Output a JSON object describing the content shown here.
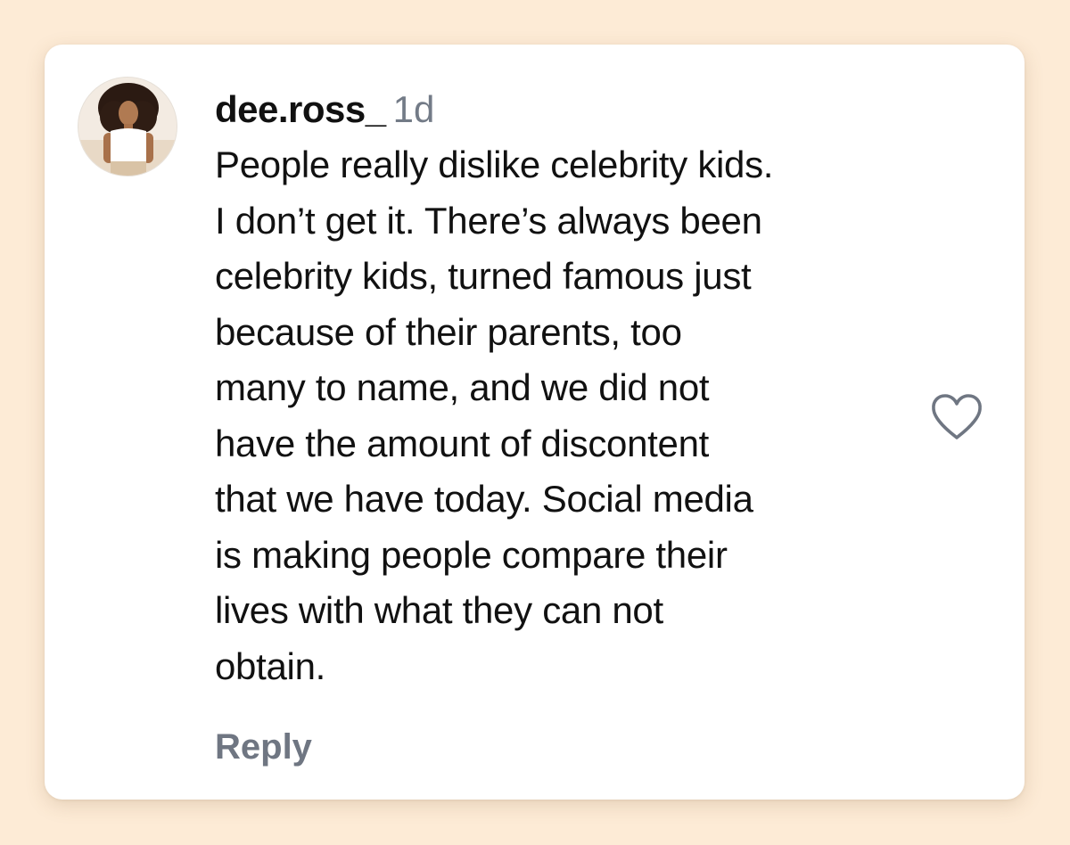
{
  "comment": {
    "username": "dee.ross_",
    "timestamp": "1d",
    "text": "People really dislike celebrity kids.\nI don’t get it. There’s always been\ncelebrity kids, turned famous just\nbecause of their parents, too\nmany to name, and we did not\nhave the amount of discontent\nthat we have today. Social media\nis making people compare their\nlives with what they can not\nobtain.",
    "reply_label": "Reply",
    "like_icon": "heart-outline-icon",
    "avatar_icon": "user-avatar-photo"
  },
  "colors": {
    "background": "#fdebd6",
    "card": "#ffffff",
    "text": "#111111",
    "muted": "#737b87",
    "icon": "#6f7682"
  }
}
